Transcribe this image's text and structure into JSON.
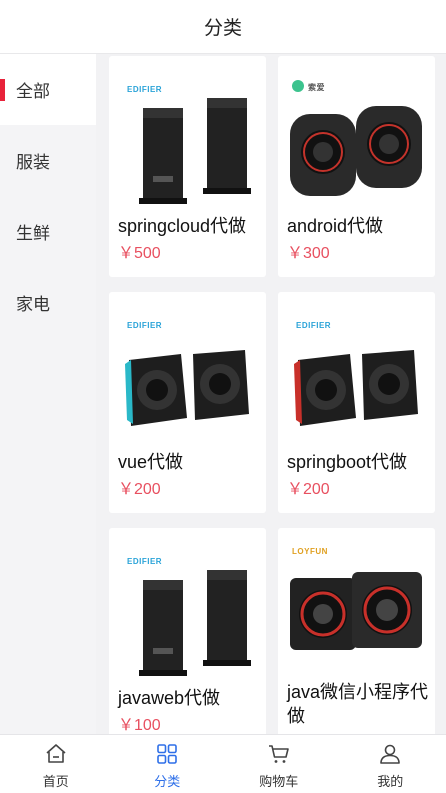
{
  "header": {
    "title": "分类"
  },
  "sidebar": {
    "items": [
      {
        "label": "全部",
        "active": true
      },
      {
        "label": "服装",
        "active": false
      },
      {
        "label": "生鲜",
        "active": false
      },
      {
        "label": "家电",
        "active": false
      }
    ]
  },
  "products": [
    {
      "name": "springcloud代做",
      "price": "￥500",
      "brand": "EDIFIER",
      "image": "tall-speakers"
    },
    {
      "name": "android代做",
      "price": "￥300",
      "brand": "索爱",
      "image": "round-speakers-red"
    },
    {
      "name": "vue代做",
      "price": "￥200",
      "brand": "EDIFIER",
      "image": "cube-speakers-blue"
    },
    {
      "name": "springboot代做",
      "price": "￥200",
      "brand": "EDIFIER",
      "image": "cube-speakers-red"
    },
    {
      "name": "javaweb代做",
      "price": "￥100",
      "brand": "EDIFIER",
      "image": "tall-speakers"
    },
    {
      "name": "java微信小程序代做",
      "price": "",
      "brand": "LOYFUN",
      "image": "box-speakers"
    }
  ],
  "tabbar": {
    "items": [
      {
        "label": "首页",
        "icon": "home-icon",
        "active": false
      },
      {
        "label": "分类",
        "icon": "grid-icon",
        "active": true
      },
      {
        "label": "购物车",
        "icon": "cart-icon",
        "active": false
      },
      {
        "label": "我的",
        "icon": "user-icon",
        "active": false
      }
    ]
  },
  "colors": {
    "accent": "#2e6fe8",
    "price": "#e85060",
    "indicator": "#e8223a"
  }
}
